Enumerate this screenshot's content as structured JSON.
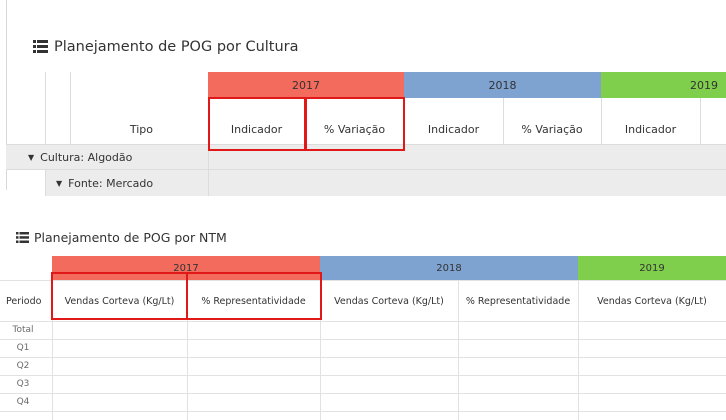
{
  "panel_cultura": {
    "title": "Planejamento de POG por Cultura",
    "years": [
      "2017",
      "2018",
      "2019"
    ],
    "col_tipo": "Tipo",
    "sub_cols": [
      "Indicador",
      "% Variação",
      "Indicador",
      "% Variação",
      "Indicador"
    ],
    "rows": [
      {
        "label": "Cultura: Algodão",
        "expanded": true
      },
      {
        "label": "Fonte: Mercado",
        "expanded": true
      }
    ],
    "year_colors": {
      "2017": "#f26b5d",
      "2018": "#7fa3d0",
      "2019": "#7fce4c"
    }
  },
  "panel_ntm": {
    "title": "Planejamento de POG por NTM",
    "years": [
      "2017",
      "2018",
      "2019"
    ],
    "col_periodo": "Periodo",
    "sub_cols": [
      "Vendas Corteva (Kg/Lt)",
      "% Representatividade",
      "Vendas Corteva (Kg/Lt)",
      "% Representatividade",
      "Vendas Corteva (Kg/Lt)"
    ],
    "rows": [
      "Total",
      "Q1",
      "Q2",
      "Q3",
      "Q4"
    ]
  },
  "highlight_color": "#e01818"
}
